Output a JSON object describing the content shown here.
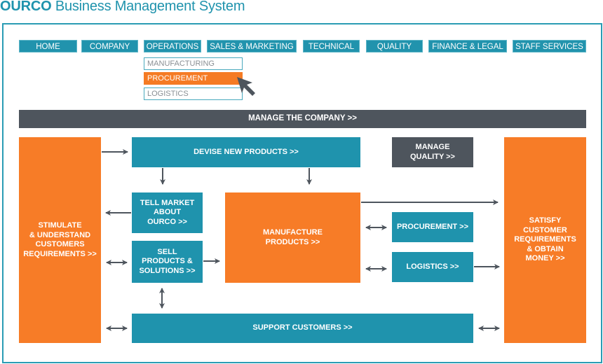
{
  "header": {
    "brand": "OURCO",
    "title": "Business Management System"
  },
  "nav": {
    "items": [
      {
        "label": "HOME"
      },
      {
        "label": "COMPANY"
      },
      {
        "label": "OPERATIONS"
      },
      {
        "label": "SALES & MARKETING"
      },
      {
        "label": "TECHNICAL"
      },
      {
        "label": "QUALITY"
      },
      {
        "label": "FINANCE & LEGAL"
      },
      {
        "label": "STAFF SERVICES"
      }
    ],
    "operations_dropdown": [
      {
        "label": "MANUFACTURING",
        "active": false
      },
      {
        "label": "PROCUREMENT",
        "active": true
      },
      {
        "label": "LOGISTICS",
        "active": false
      }
    ]
  },
  "diagram": {
    "manage_company": "MANAGE THE COMPANY >>",
    "stimulate": [
      "STIMULATE",
      "& UNDERSTAND",
      "CUSTOMERS",
      "REQUIREMENTS >>"
    ],
    "devise": "DEVISE NEW PRODUCTS >>",
    "manage_quality": [
      "MANAGE",
      "QUALITY >>"
    ],
    "satisfy": [
      "SATISFY",
      "CUSTOMER",
      "REQUIREMENTS",
      "& OBTAIN",
      "MONEY >>"
    ],
    "tell_market": [
      "TELL MARKET",
      "ABOUT",
      "OURCO >>"
    ],
    "sell": [
      "SELL",
      "PRODUCTS &",
      "SOLUTIONS >>"
    ],
    "manufacture": [
      "MANUFACTURE",
      "PRODUCTS >>"
    ],
    "procurement": "PROCUREMENT >>",
    "logistics": "LOGISTICS >>",
    "support": "SUPPORT CUSTOMERS >>"
  },
  "colors": {
    "teal": "#1f93ad",
    "orange": "#f77c27",
    "gray": "#4e555d",
    "arrow": "#4e555d"
  }
}
